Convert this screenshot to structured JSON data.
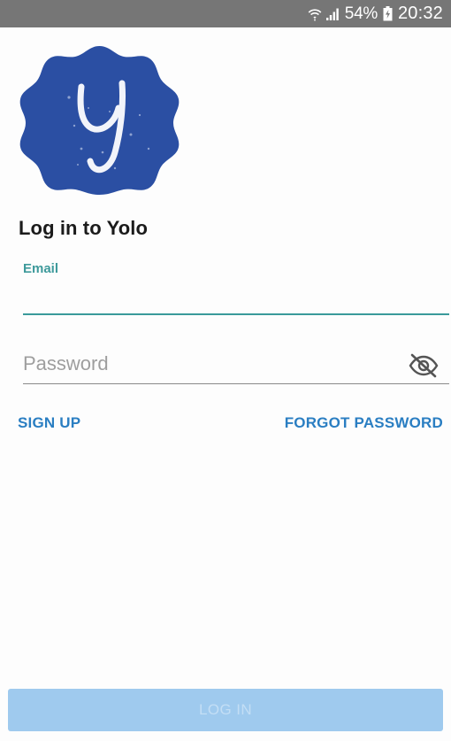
{
  "status_bar": {
    "battery_percent": "54%",
    "time": "20:32",
    "icons": [
      "wifi-icon",
      "signal-icon",
      "battery-charging-icon"
    ]
  },
  "logo": {
    "icon": "yolo-badge-logo",
    "letter": "y",
    "color": "#2b4fa3"
  },
  "title": "Log in to Yolo",
  "email": {
    "label": "Email",
    "value": "",
    "accent_color": "#3a9a9b"
  },
  "password": {
    "placeholder": "Password",
    "value": "",
    "toggle_icon": "eye-off-icon"
  },
  "links": {
    "sign_up": "SIGN UP",
    "forgot_password": "FORGOT PASSWORD",
    "color": "#2a7ec2"
  },
  "login_button": {
    "label": "LOG IN",
    "state": "disabled",
    "color": "#9fcaee"
  }
}
